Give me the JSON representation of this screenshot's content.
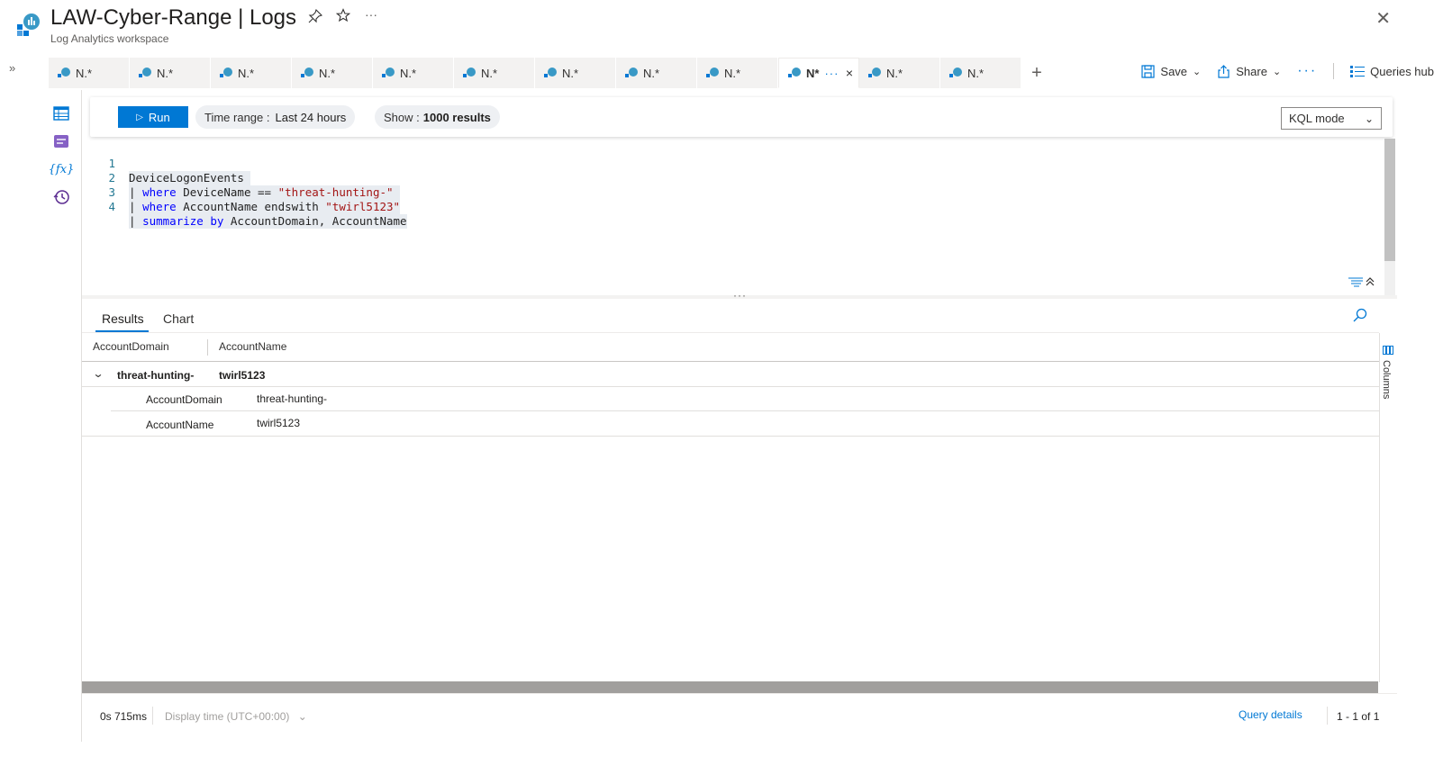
{
  "header": {
    "title": "LAW-Cyber-Range | Logs",
    "subtitle": "Log Analytics workspace",
    "pin_icon": "pin-icon",
    "star_icon": "star-icon",
    "more_glyph": "···",
    "close_glyph": "✕"
  },
  "sidebar_toggle": "»",
  "tabs": [
    {
      "label": "N.*"
    },
    {
      "label": "N.*"
    },
    {
      "label": "N.*"
    },
    {
      "label": "N.*"
    },
    {
      "label": "N.*"
    },
    {
      "label": "N.*"
    },
    {
      "label": "N.*"
    },
    {
      "label": "N.*"
    },
    {
      "label": "N.*"
    },
    {
      "label": "N*",
      "active": true
    },
    {
      "label": "N.*"
    },
    {
      "label": "N.*"
    }
  ],
  "active_tab": {
    "label": "N*",
    "more": "···",
    "close": "×"
  },
  "tab_add": "+",
  "toolbar": {
    "save_label": "Save",
    "share_label": "Share",
    "more": "···",
    "queries_hub_label": "Queries hub"
  },
  "query_bar": {
    "run_label": "Run",
    "time_range_prefix": "Time range :",
    "time_range_value": "Last 24 hours",
    "show_prefix": "Show :",
    "show_value": "1000 results",
    "mode_label": "KQL mode"
  },
  "editor": {
    "lines": [
      {
        "num": "1"
      },
      {
        "num": "2"
      },
      {
        "num": "3"
      },
      {
        "num": "4"
      }
    ],
    "line1": "DeviceLogonEvents",
    "line2_pipe": "| ",
    "line2_kw": "where",
    "line2_mid": " DeviceName == ",
    "line2_str": "\"threat-hunting-\"",
    "line3_pipe": "| ",
    "line3_kw": "where",
    "line3_mid": " AccountName endswith ",
    "line3_str": "\"twirl5123\"",
    "line4_pipe": "| ",
    "line4_kw": "summarize by",
    "line4_mid": " AccountDomain, AccountName"
  },
  "splitter": "···",
  "results": {
    "tab_results": "Results",
    "tab_chart": "Chart",
    "columns": [
      "AccountDomain",
      "AccountName"
    ],
    "group_row": {
      "domain": "threat-hunting-",
      "name": "twirl5123"
    },
    "detail_rows": [
      {
        "label": "AccountDomain",
        "value": "threat-hunting-"
      },
      {
        "label": "AccountName",
        "value": "twirl5123"
      }
    ],
    "columns_panel_label": "Columns"
  },
  "footer": {
    "duration": "0s 715ms",
    "display_time": "Display time (UTC+00:00)",
    "query_details": "Query details",
    "paging": "1 - 1 of 1"
  },
  "colors": {
    "accent": "#0078d4",
    "keyword": "#0000ff",
    "string": "#a31515"
  }
}
